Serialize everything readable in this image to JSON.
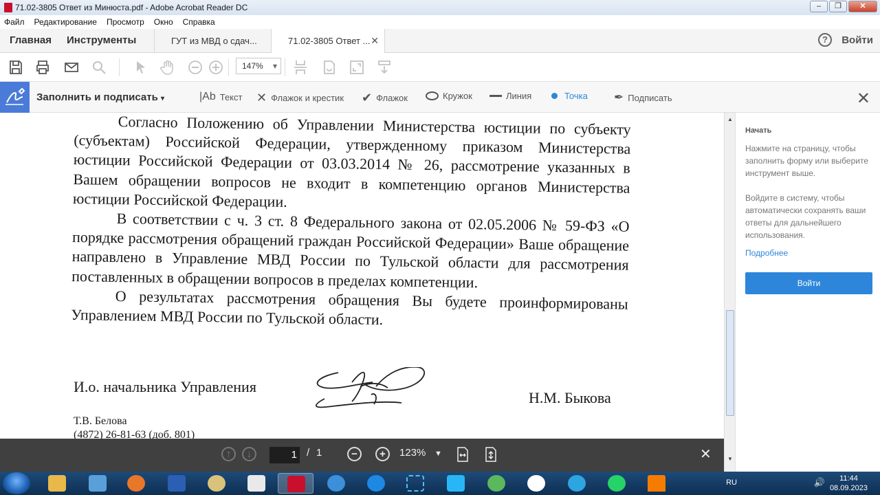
{
  "window": {
    "title": "71.02-3805 Ответ из Минюста.pdf - Adobe Acrobat Reader DC"
  },
  "menu": [
    "Файл",
    "Редактирование",
    "Просмотр",
    "Окно",
    "Справка"
  ],
  "tabs": {
    "home": "Главная",
    "tools": "Инструменты",
    "doc1": "ГУТ из МВД о сдач...",
    "doc2": "71.02-3805 Ответ ...",
    "login": "Войти"
  },
  "toolbar": {
    "zoom": "147%"
  },
  "fill_sign": {
    "title": "Заполнить и подписать",
    "tools": {
      "text": "Текст",
      "cross": "Флажок и крестик",
      "check": "Флажок",
      "circle": "Кружок",
      "line": "Линия",
      "dot": "Точка",
      "sign": "Подписать"
    }
  },
  "document": {
    "p1": "Согласно Положению об Управлении Министерства юстиции по субъекту (субъектам) Российской Федерации, утвержденному приказом Министерства юстиции Российской Федерации от 03.03.2014 № 26, рассмотрение указанных в Вашем обращении вопросов не входит в компетенцию органов Министерства юстиции Российской Федерации.",
    "p2": "В соответствии с ч. 3 ст. 8 Федерального закона от 02.05.2006 № 59-ФЗ «О порядке рассмотрения обращений граждан Российской Федерации» Ваше обращение направлено в Управление МВД России по Тульской области для рассмотрения поставленных в обращении вопросов в пределах компетенции.",
    "p3": "О результатах рассмотрения обращения Вы будете проинформированы Управлением МВД России по Тульской области.",
    "signer_title": "И.о. начальника Управления",
    "signer_name": "Н.М. Быкова",
    "executor": "Т.В. Белова",
    "phone": "(4872) 26-81-63 (доб. 801)"
  },
  "page_nav": {
    "current": "1",
    "separator": "/",
    "total": "1",
    "zoom": "123%"
  },
  "right_panel": {
    "title": "Начать",
    "text1": "Нажмите на страницу, чтобы заполнить форму или выберите инструмент выше.",
    "text2": "Войдите в систему, чтобы автоматически сохранять ваши ответы для дальнейшего использования.",
    "link": "Подробнее",
    "button": "Войти"
  },
  "taskbar": {
    "lang": "RU",
    "time": "11:44",
    "date": "08.09.2023"
  },
  "colors": {
    "accent": "#2d86d9",
    "fill_sign_blue": "#4b7bd9",
    "nav_bg": "#333333"
  }
}
